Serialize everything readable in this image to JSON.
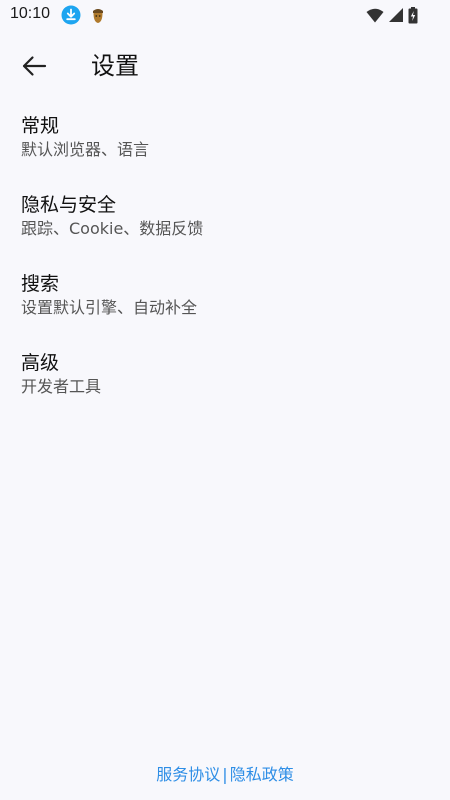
{
  "status_bar": {
    "time": "10:10",
    "icons": [
      "download-icon",
      "app-notification-icon",
      "wifi-icon",
      "cell-signal-icon",
      "battery-charging-icon"
    ]
  },
  "header": {
    "title": "设置",
    "back_icon": "arrow-left-icon"
  },
  "settings": {
    "items": [
      {
        "title": "常规",
        "subtitle": "默认浏览器、语言"
      },
      {
        "title": "隐私与安全",
        "subtitle": "跟踪、Cookie、数据反馈"
      },
      {
        "title": "搜索",
        "subtitle": "设置默认引擎、自动补全"
      },
      {
        "title": "高级",
        "subtitle": "开发者工具"
      }
    ]
  },
  "footer": {
    "terms_label": "服务协议",
    "separator": "|",
    "privacy_label": "隐私政策"
  },
  "colors": {
    "background": "#f8f8fc",
    "link": "#2e8ee6",
    "download_badge": "#1ea5f0"
  }
}
